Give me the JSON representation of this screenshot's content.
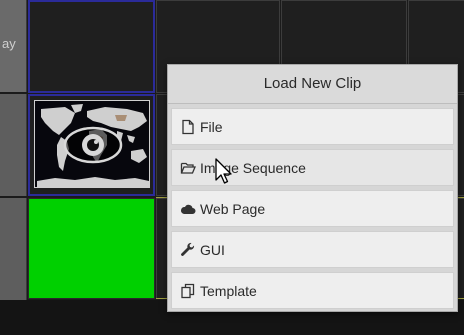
{
  "grid": {
    "row_header_label": "ay"
  },
  "menu": {
    "title": "Load New Clip",
    "items": [
      {
        "label": "File",
        "icon": "file-icon"
      },
      {
        "label": "Image Sequence",
        "icon": "folder-open-icon"
      },
      {
        "label": "Web Page",
        "icon": "cloud-icon"
      },
      {
        "label": "GUI",
        "icon": "wrench-icon"
      },
      {
        "label": "Template",
        "icon": "template-icon"
      }
    ]
  },
  "colors": {
    "selected_border": "#2b2b9a",
    "green_clip": "#00d000",
    "menu_background": "#d6d6d6"
  },
  "thumbnail": {
    "overlay_icon": "eye-icon"
  }
}
